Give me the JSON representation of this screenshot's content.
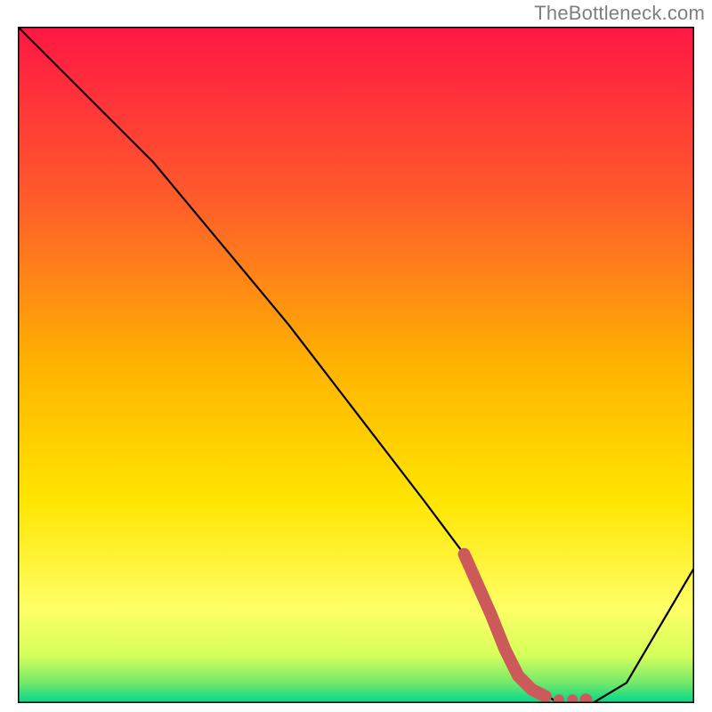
{
  "attribution": "TheBottleneck.com",
  "chart_data": {
    "type": "line",
    "title": "",
    "xlabel": "",
    "ylabel": "",
    "xlim": [
      0,
      100
    ],
    "ylim": [
      0,
      100
    ],
    "grid": false,
    "legend": false,
    "gradient_stops": [
      {
        "offset": 0.0,
        "color": "#ff1744"
      },
      {
        "offset": 0.25,
        "color": "#ff5a2c"
      },
      {
        "offset": 0.5,
        "color": "#ffb300"
      },
      {
        "offset": 0.7,
        "color": "#ffe500"
      },
      {
        "offset": 0.86,
        "color": "#ffff66"
      },
      {
        "offset": 0.93,
        "color": "#d4ff5a"
      },
      {
        "offset": 0.97,
        "color": "#74e86a"
      },
      {
        "offset": 1.0,
        "color": "#00d68f"
      }
    ],
    "series": [
      {
        "name": "bottleneck-curve",
        "color": "#000000",
        "x": [
          0,
          10,
          20,
          25,
          30,
          40,
          50,
          60,
          66,
          70,
          75,
          80,
          85,
          90,
          100
        ],
        "y": [
          100,
          90,
          80,
          74,
          68,
          56,
          43,
          30,
          22,
          13,
          3,
          0,
          0,
          3,
          20
        ]
      },
      {
        "name": "optimal-zone",
        "color": "#cc5a5a",
        "style": "thick-dotted",
        "x": [
          66,
          70,
          72,
          74,
          76,
          78,
          80,
          82,
          84
        ],
        "y": [
          22,
          13,
          8,
          4,
          2,
          1,
          0.5,
          0.5,
          0.5
        ]
      }
    ]
  }
}
